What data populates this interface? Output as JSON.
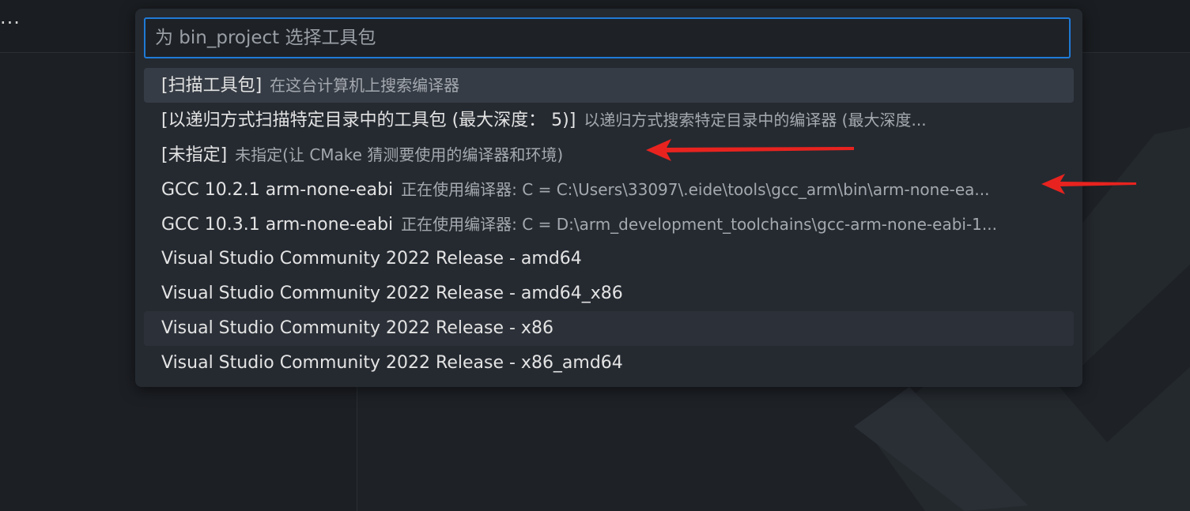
{
  "titlebar": {
    "more_label": "..."
  },
  "quickpick": {
    "placeholder": "为 bin_project 选择工具包",
    "items": [
      {
        "label": "[扫描工具包]",
        "description": "在这台计算机上搜索编译器"
      },
      {
        "label": "[以递归方式扫描特定目录中的工具包 (最大深度： 5)]",
        "description": "以递归方式搜索特定目录中的编译器 (最大深度..."
      },
      {
        "label": "[未指定]",
        "description": "未指定(让 CMake 猜测要使用的编译器和环境)"
      },
      {
        "label": "GCC 10.2.1 arm-none-eabi",
        "description": "正在使用编译器: C = C:\\Users\\33097\\.eide\\tools\\gcc_arm\\bin\\arm-none-ea..."
      },
      {
        "label": "GCC 10.3.1 arm-none-eabi",
        "description": "正在使用编译器: C = D:\\arm_development_toolchains\\gcc-arm-none-eabi-1..."
      },
      {
        "label": "Visual Studio Community 2022 Release - amd64",
        "description": ""
      },
      {
        "label": "Visual Studio Community 2022 Release - amd64_x86",
        "description": ""
      },
      {
        "label": "Visual Studio Community 2022 Release - x86",
        "description": ""
      },
      {
        "label": "Visual Studio Community 2022 Release - x86_amd64",
        "description": ""
      }
    ]
  },
  "colors": {
    "accent": "#1f7ad6",
    "annotation_arrow": "#e8231f"
  }
}
